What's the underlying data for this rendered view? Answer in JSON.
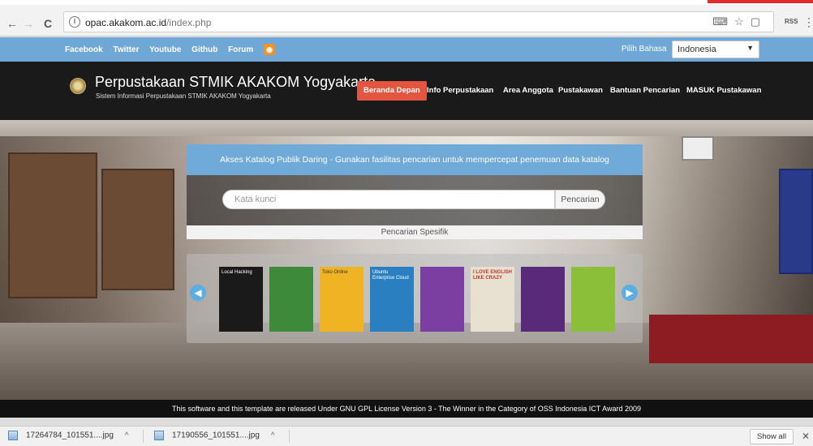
{
  "browser": {
    "url_host": "opac.akakom.ac.id",
    "url_path": "/index.php",
    "back_icon": "←",
    "forward_icon": "→",
    "reload_icon": "C",
    "ext_label": "RSS",
    "menu_icon": "⋮"
  },
  "topbar": {
    "links": [
      "Facebook",
      "Twitter",
      "Youtube",
      "Github",
      "Forum"
    ],
    "lang_label": "Pilih Bahasa",
    "lang_selected": "Indonesia"
  },
  "header": {
    "title": "Perpustakaan STMIK AKAKOM Yogyakarta",
    "subtitle": "Sistem Informasi Perpustakaan STMIK AKAKOM Yogyakarta",
    "menu": [
      "Beranda Depan",
      "Info Perpustakaan",
      "Area Anggota",
      "Pustakawan",
      "Bantuan Pencarian",
      "MASUK Pustakawan"
    ]
  },
  "hero": {
    "banner": "Akses Katalog Publik Daring - Gunakan fasilitas pencarian untuk mempercepat penemuan data katalog",
    "search_placeholder": "Kata kunci",
    "search_button": "Pencarian",
    "specific_search": "Pencarian Spesifik"
  },
  "books": [
    {
      "title": "Local Hacking",
      "color": "#1a1a1a"
    },
    {
      "title": "",
      "color": "#3d8a3b"
    },
    {
      "title": "Toko Online",
      "color": "#f0b323"
    },
    {
      "title": "Ubuntu Enterprise Cloud",
      "color": "#2a7fc1"
    },
    {
      "title": "",
      "color": "#7a3fa0"
    },
    {
      "title": "I LOVE ENGLISH LIKE CRAZY",
      "color": "#e8e0d0"
    },
    {
      "title": "",
      "color": "#5a2a7a"
    },
    {
      "title": "",
      "color": "#8bbf3a"
    }
  ],
  "footer": {
    "text": "This software and this template are released Under GNU GPL License Version 3 - The Winner in the Category of OSS Indonesia ICT Award 2009"
  },
  "downloads": {
    "items": [
      "17264784_101551....jpg",
      "17190556_101551....jpg"
    ],
    "show_all": "Show all"
  }
}
